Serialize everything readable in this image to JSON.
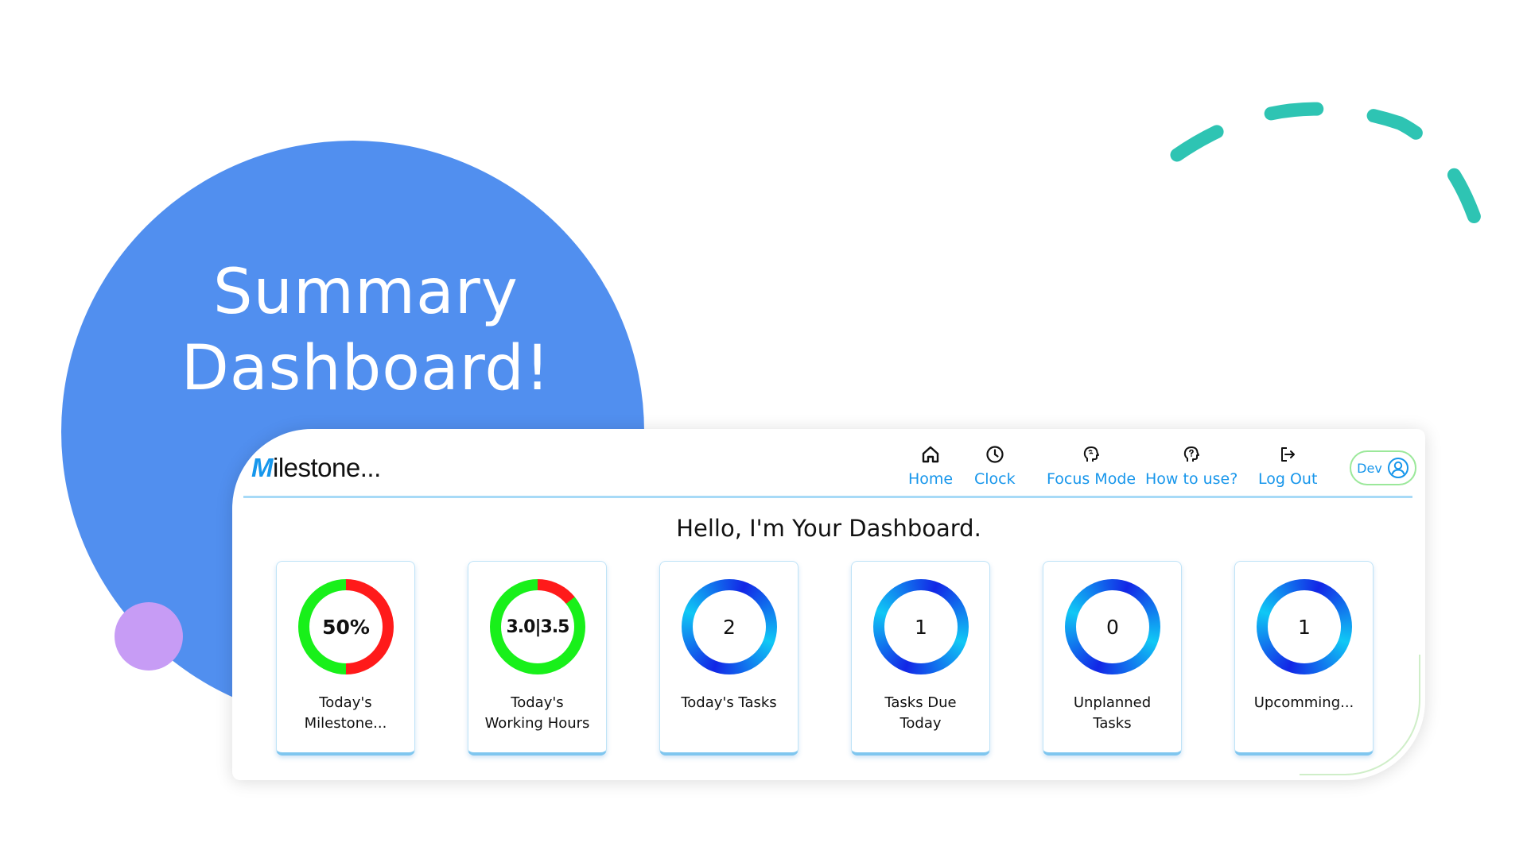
{
  "hero": {
    "title_line1": "Summary",
    "title_line2": "Dashboard!"
  },
  "colors": {
    "hero_circle": "#518FEF",
    "accent_dot": "#C79CF5",
    "dash_arc": "#2EC4B3",
    "link_blue": "#1796EB",
    "progress_red": "#FF1A1A",
    "progress_green": "#18F01A",
    "ring_blue_dark": "#1226E6",
    "ring_blue_light": "#10C8F5"
  },
  "app": {
    "brand_initial": "M",
    "brand_rest": "ilestone...",
    "nav": [
      {
        "label": "Home",
        "icon": "home-icon"
      },
      {
        "label": "Clock",
        "icon": "clock-icon"
      },
      {
        "label": "Focus Mode",
        "icon": "brain-head-icon"
      },
      {
        "label": "How to use?",
        "icon": "question-head-icon"
      },
      {
        "label": "Log Out",
        "icon": "logout-icon"
      }
    ],
    "user": {
      "name": "Dev",
      "icon": "user-avatar-icon"
    },
    "greeting": "Hello, I'm Your Dashboard."
  },
  "cards": [
    {
      "value": "50%",
      "label_line1": "Today's",
      "label_line2": "Milestone...",
      "ring": "progress",
      "progress": 0.5
    },
    {
      "value": "3.0|3.5",
      "label_line1": "Today's",
      "label_line2": "Working Hours",
      "ring": "progress",
      "progress": 0.857
    },
    {
      "value": "2",
      "label_line1": "Today's Tasks",
      "label_line2": "",
      "ring": "gradient"
    },
    {
      "value": "1",
      "label_line1": "Tasks Due",
      "label_line2": "Today",
      "ring": "gradient"
    },
    {
      "value": "0",
      "label_line1": "Unplanned",
      "label_line2": "Tasks",
      "ring": "gradient"
    },
    {
      "value": "1",
      "label_line1": "Upcomming...",
      "label_line2": "",
      "ring": "gradient"
    }
  ]
}
